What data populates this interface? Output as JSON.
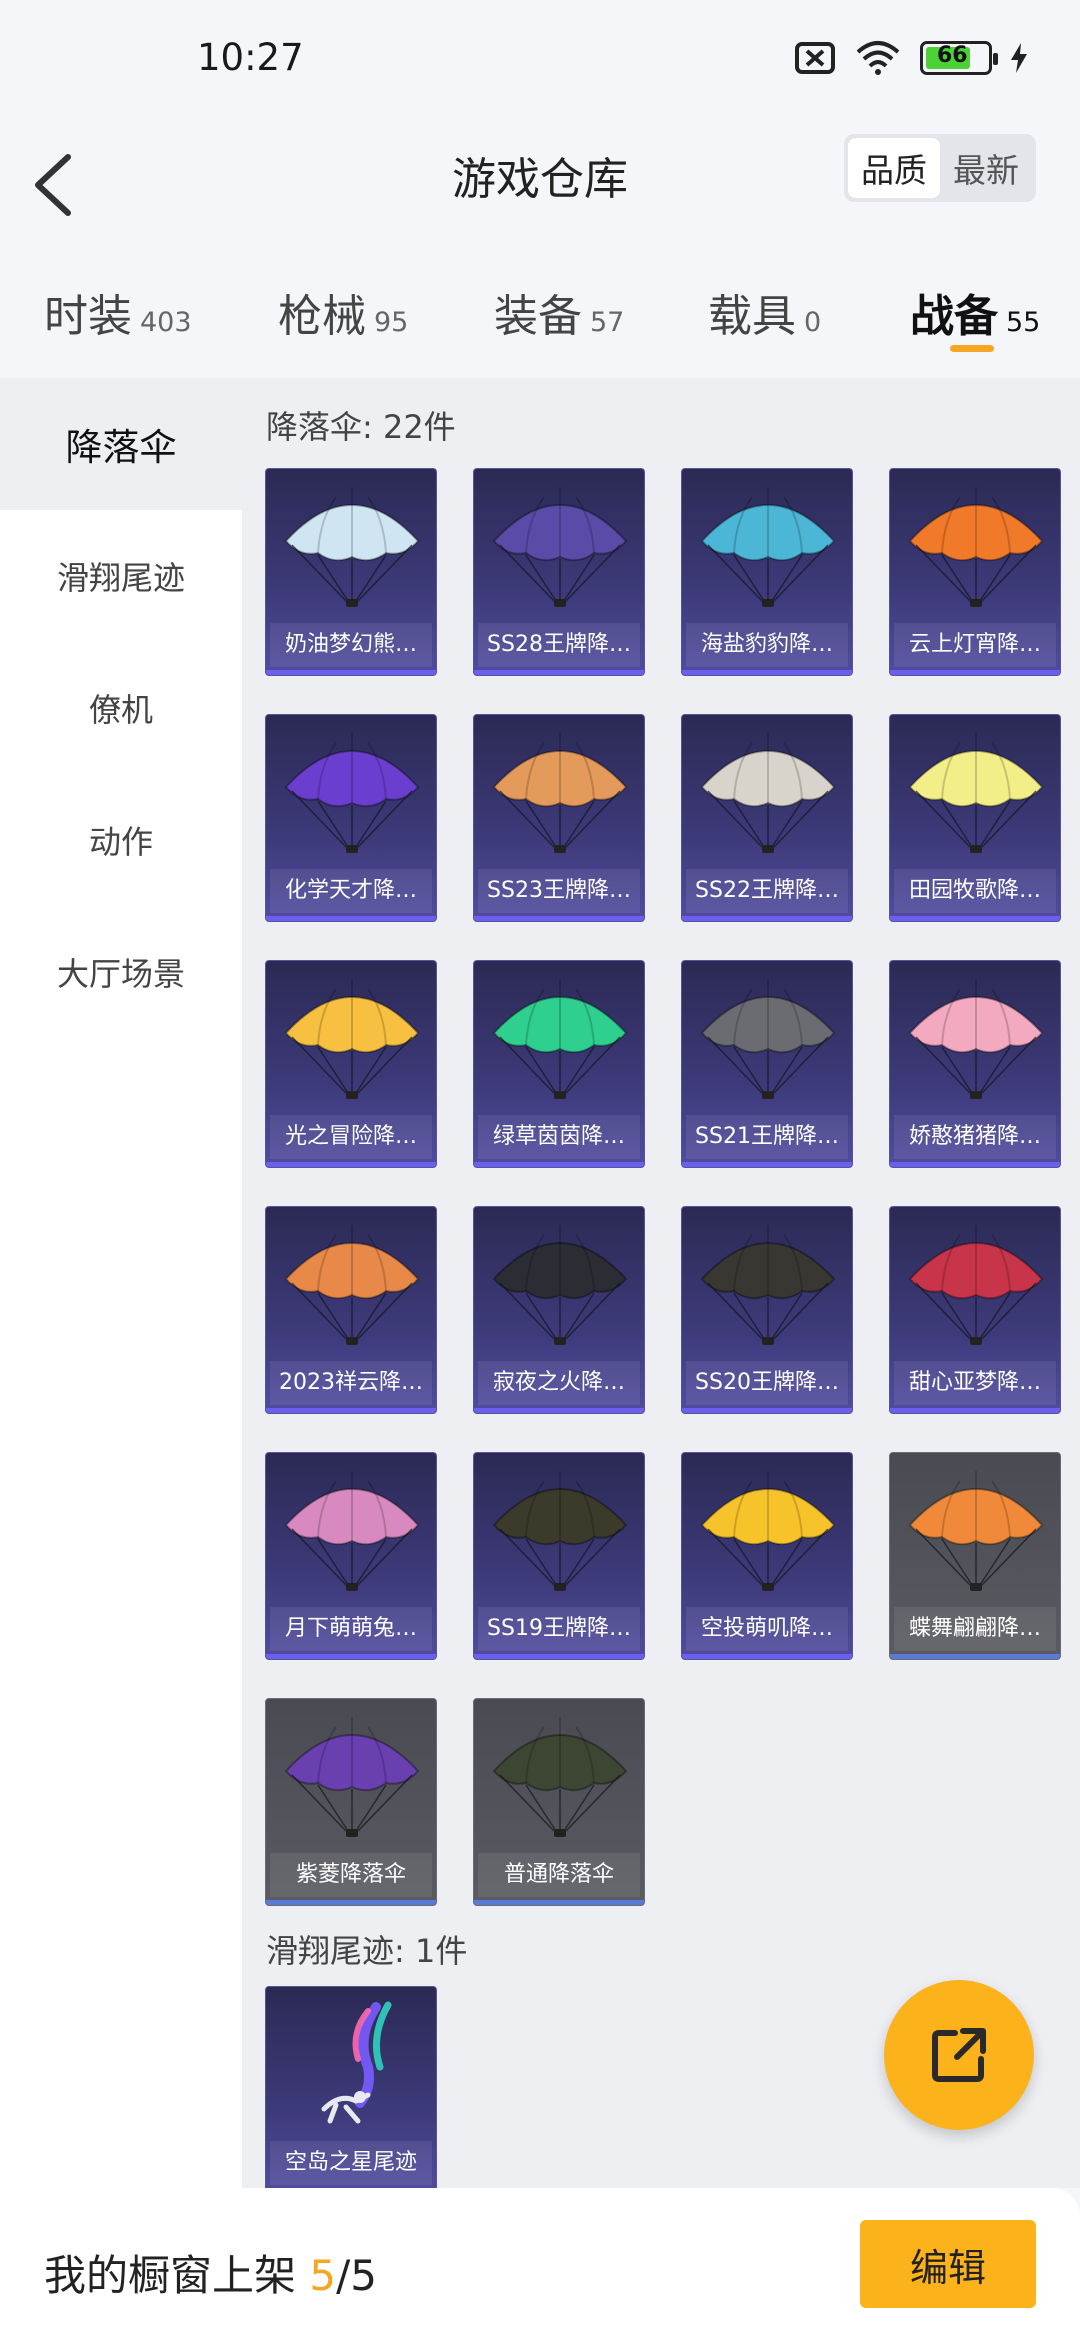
{
  "status": {
    "time": "10:27",
    "battery": "66"
  },
  "header": {
    "title": "游戏仓库",
    "sort_quality": "品质",
    "sort_newest": "最新"
  },
  "tabs": [
    {
      "label": "时装",
      "count": "403"
    },
    {
      "label": "枪械",
      "count": "95"
    },
    {
      "label": "装备",
      "count": "57"
    },
    {
      "label": "载具",
      "count": "0"
    },
    {
      "label": "战备",
      "count": "55"
    }
  ],
  "sidebar": {
    "items": [
      "降落伞",
      "滑翔尾迹",
      "僚机",
      "动作",
      "大厅场景"
    ]
  },
  "sections": {
    "parachute_title": "降落伞: 22件",
    "trail_title": "滑翔尾迹: 1件"
  },
  "parachutes": [
    "奶油梦幻熊…",
    "SS28王牌降…",
    "海盐豹豹降…",
    "云上灯宵降…",
    "化学天才降…",
    "SS23王牌降…",
    "SS22王牌降…",
    "田园牧歌降…",
    "光之冒险降…",
    "绿草茵茵降…",
    "SS21王牌降…",
    "娇憨猪猪降…",
    "2023祥云降…",
    "寂夜之火降…",
    "SS20王牌降…",
    "甜心亚梦降…",
    "月下萌萌兔…",
    "SS19王牌降…",
    "空投萌叽降…",
    "蝶舞翩翩降…",
    "紫菱降落伞",
    "普通降落伞"
  ],
  "parachute_colors": [
    "#cfe6f2",
    "#5a4ba8",
    "#4bb6d6",
    "#f07a2a",
    "#6a3fd0",
    "#e39a5a",
    "#d8d4cc",
    "#f2ee88",
    "#f7c040",
    "#2fcf8f",
    "#6b6b72",
    "#f3a9c0",
    "#e8894a",
    "#2c2c34",
    "#3a3632",
    "#c8344a",
    "#d88ac0",
    "#3c3a2a",
    "#f6c42a",
    "#f08a3a",
    "#6a3fb0",
    "#3d4632"
  ],
  "trails": [
    "空岛之星尾迹"
  ],
  "bottom": {
    "label": "我的橱窗上架 ",
    "current": "5",
    "total": "/5",
    "edit": "编辑"
  },
  "icons": {
    "back": "chevron-left-icon",
    "share": "share-external-icon",
    "wifi": "wifi-icon",
    "sim": "no-sim-icon",
    "charging": "bolt-icon"
  }
}
